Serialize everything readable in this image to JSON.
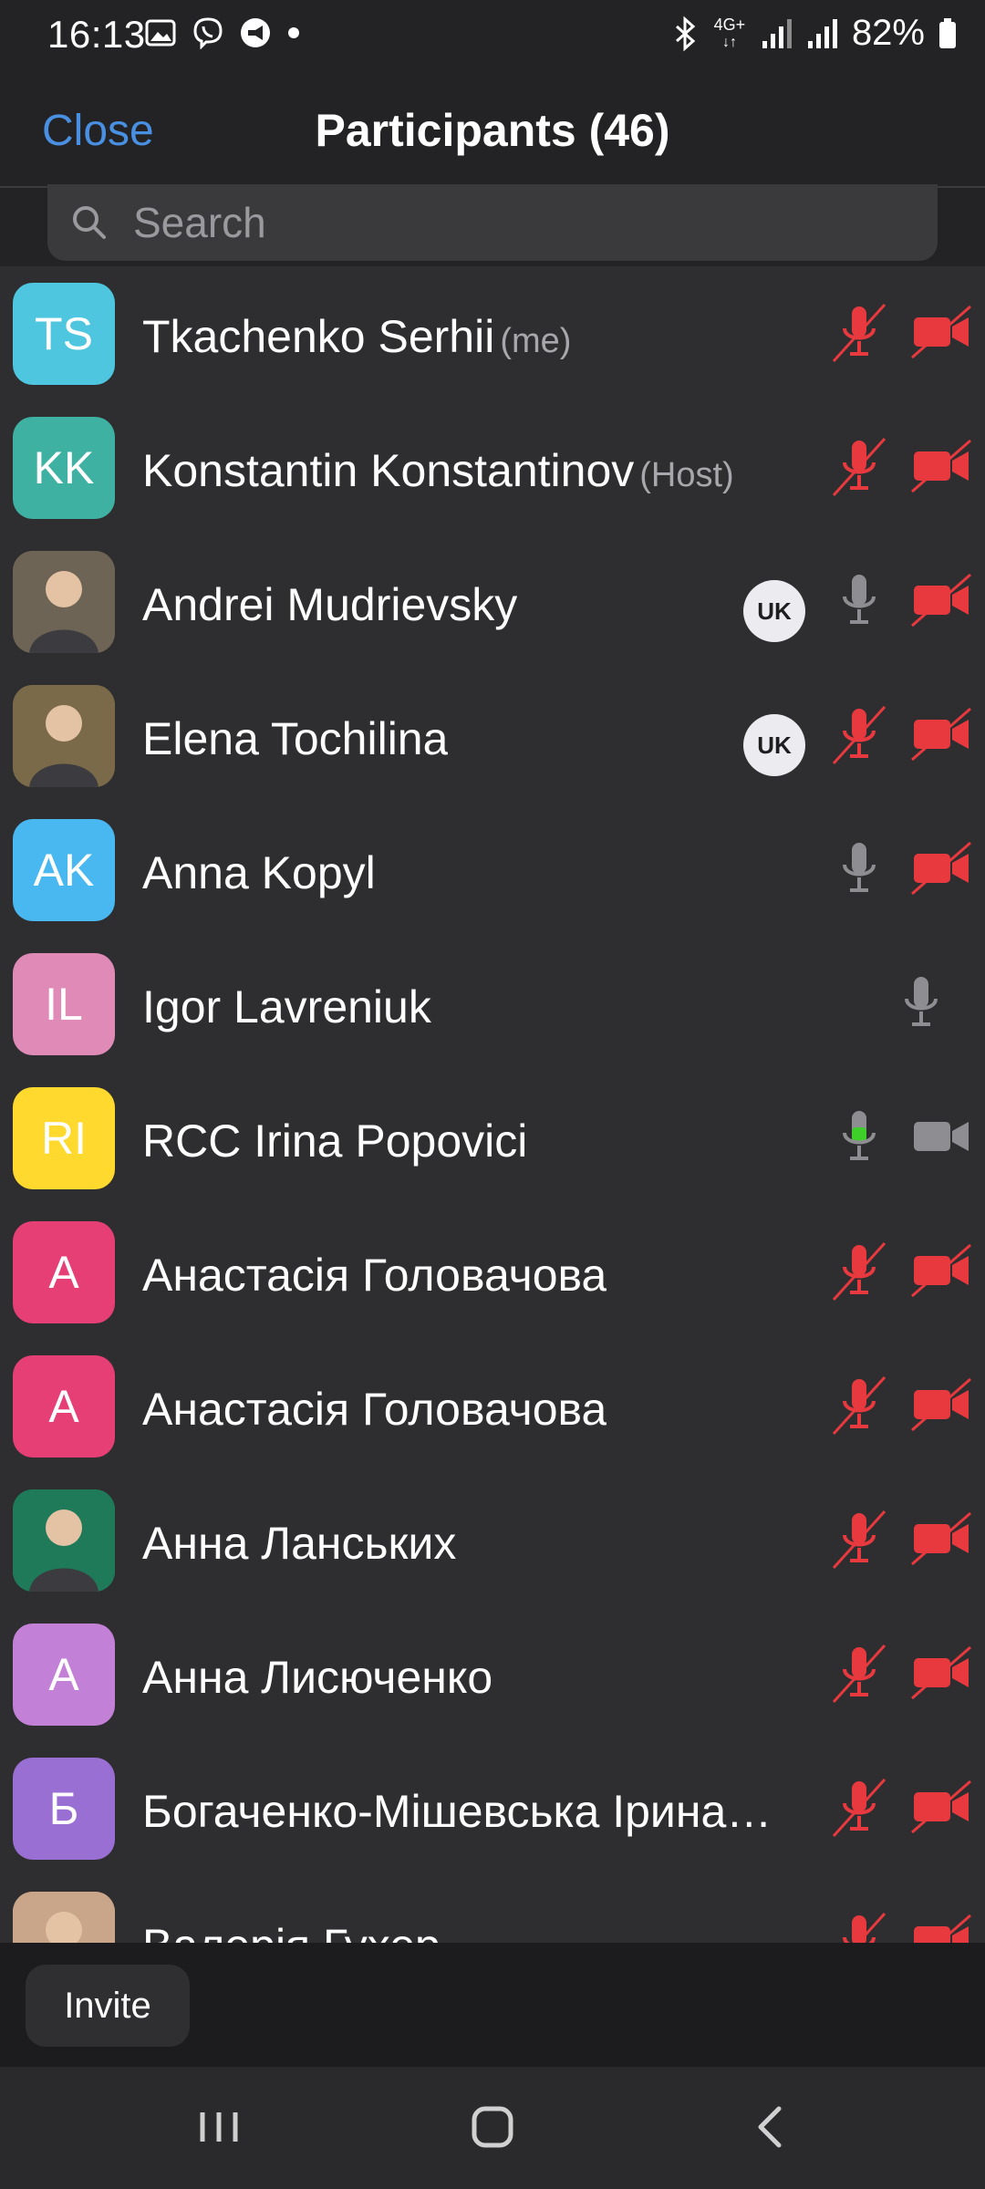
{
  "status_bar": {
    "time": "16:13",
    "network": "4G+",
    "battery": "82%"
  },
  "header": {
    "close_label": "Close",
    "title": "Participants (46)"
  },
  "search": {
    "placeholder": "Search"
  },
  "participants": [
    {
      "name": "Tkachenko Serhii",
      "tag": "(me)",
      "initials": "TS",
      "color": "#4fc6df",
      "language": "",
      "mic": "muted",
      "video": "off"
    },
    {
      "name": "Konstantin Konstantinov",
      "tag": "(Host)",
      "initials": "KK",
      "color": "#3fb1a3",
      "language": "",
      "mic": "muted",
      "video": "off"
    },
    {
      "name": "Andrei Mudrievsky",
      "tag": "",
      "initials": "",
      "color": "#6d6456",
      "language": "UK",
      "mic": "on",
      "video": "off"
    },
    {
      "name": "Elena Tochilina",
      "tag": "",
      "initials": "",
      "color": "#7a6a4a",
      "language": "UK",
      "mic": "muted",
      "video": "off"
    },
    {
      "name": "Anna Kopyl",
      "tag": "",
      "initials": "AK",
      "color": "#4ab8f0",
      "language": "",
      "mic": "on",
      "video": "off"
    },
    {
      "name": "Igor Lavreniuk",
      "tag": "",
      "initials": "IL",
      "color": "#e08ab8",
      "language": "",
      "mic": "on",
      "video": "none"
    },
    {
      "name": "RCC Irina Popovici",
      "tag": "",
      "initials": "RI",
      "color": "#ffd92e",
      "language": "",
      "mic": "speaking",
      "video": "on"
    },
    {
      "name": "Анастасія Головачова",
      "tag": "",
      "initials": "А",
      "color": "#e63f76",
      "language": "",
      "mic": "muted",
      "video": "off"
    },
    {
      "name": "Анастасія Головачова",
      "tag": "",
      "initials": "А",
      "color": "#e63f76",
      "language": "",
      "mic": "muted",
      "video": "off"
    },
    {
      "name": "Анна Ланських",
      "tag": "",
      "initials": "",
      "color": "#1f7a5a",
      "language": "",
      "mic": "muted",
      "video": "off"
    },
    {
      "name": "Анна Лисюченко",
      "tag": "",
      "initials": "А",
      "color": "#c280d6",
      "language": "",
      "mic": "muted",
      "video": "off"
    },
    {
      "name": "Богаченко-Мішевська Ірина…",
      "tag": "",
      "initials": "Б",
      "color": "#9a6fd3",
      "language": "",
      "mic": "muted",
      "video": "off"
    },
    {
      "name": "Валерія Гухер",
      "tag": "",
      "initials": "",
      "color": "#c9a68a",
      "language": "",
      "mic": "muted",
      "video": "off"
    }
  ],
  "bottom_bar": {
    "invite_label": "Invite"
  },
  "colors": {
    "accent_blue": "#4a90e2",
    "muted_red": "#e8393f",
    "speaking_green": "#3ecf2a",
    "icon_gray": "#8e8e92"
  }
}
